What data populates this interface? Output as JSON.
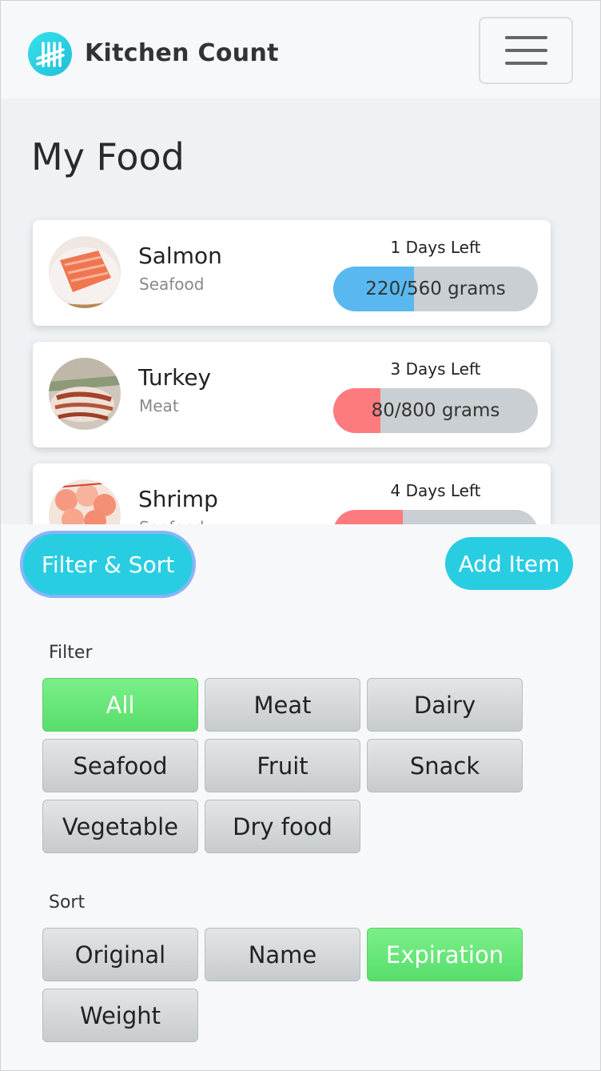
{
  "header": {
    "brand": "Kitchen Count",
    "logo_icon": "tally-marks-icon",
    "menu_icon": "hamburger-menu-icon"
  },
  "main": {
    "title": "My Food",
    "items": [
      {
        "name": "Salmon",
        "category": "Seafood",
        "days_left": "1 Days Left",
        "amount": "220/560 grams",
        "fill_fraction": 0.393,
        "fill_color": "#5ab8f0",
        "image": "salmon-photo"
      },
      {
        "name": "Turkey",
        "category": "Meat",
        "days_left": "3 Days Left",
        "amount": "80/800 grams",
        "fill_fraction": 0.23,
        "fill_color": "#fd7b7e",
        "image": "turkey-photo"
      },
      {
        "name": "Shrimp",
        "category": "Seafood",
        "days_left": "4 Days Left",
        "amount": "",
        "fill_fraction": 0.34,
        "fill_color": "#fd7b7e",
        "image": "shrimp-photo"
      }
    ]
  },
  "panel": {
    "filter_sort_label": "Filter & Sort",
    "add_item_label": "Add Item",
    "filter_label": "Filter",
    "filters": [
      "All",
      "Meat",
      "Dairy",
      "Seafood",
      "Fruit",
      "Snack",
      "Vegetable",
      "Dry food"
    ],
    "active_filter": "All",
    "sort_label": "Sort",
    "sorts": [
      "Original",
      "Name",
      "Expiration",
      "Weight"
    ],
    "active_sort": "Expiration"
  },
  "colors": {
    "accent": "#29cde2",
    "active_chip": "#63e476"
  }
}
